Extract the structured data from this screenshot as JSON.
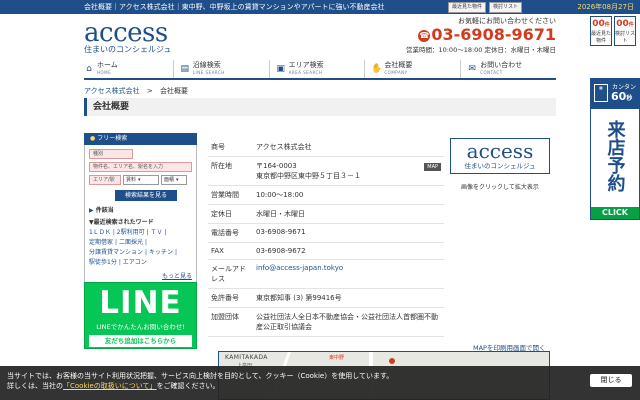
{
  "topbar": {
    "text": "会社概要｜アクセス株式会社｜東中野、中野坂上の賃貸マンションやアパートに強い不動産会社",
    "date": "2026年08月27日"
  },
  "logo": {
    "word": "access",
    "sub": "住まいのコンシェルジュ"
  },
  "header": {
    "tools": [
      "最近見た物件",
      "検討リスト"
    ],
    "tel_lead": "お気軽にお問い合わせください",
    "tel": "03-6908-9671",
    "hours": "営業時間：10:00〜18:00 定休日：水曜日・木曜日",
    "history": {
      "count": "00",
      "unit": "件",
      "label": "最近見た物件"
    },
    "watchlist": {
      "count": "00",
      "unit": "件",
      "label": "検討リスト"
    }
  },
  "nav": [
    {
      "label": "ホーム",
      "en": "HOME",
      "icon": "home-icon"
    },
    {
      "label": "沿線検索",
      "en": "LINE SEARCH",
      "icon": "train-icon"
    },
    {
      "label": "エリア検索",
      "en": "AREA SEARCH",
      "icon": "bus-icon"
    },
    {
      "label": "会社概要",
      "en": "COMPANY",
      "icon": "handshake-icon"
    },
    {
      "label": "お問い合わせ",
      "en": "CONTACT",
      "icon": "mail-icon"
    }
  ],
  "breadcrumb": {
    "home": "アクセス株式会社",
    "sep": ">",
    "current": "会社概要"
  },
  "page_title": "会社概要",
  "sidebar": {
    "header": "フリー検索",
    "type_placeholder": "種別",
    "keyword_placeholder": "物件名、エリア名、駅名を入力",
    "area_placeholder": "エリア/駅",
    "select_price": "賃料",
    "select_area": "面積",
    "search_button": "検索結果を見る",
    "cond_label": "件該当",
    "recent_title": "▼最近検索されたワード",
    "tags": [
      "1ＬＤＫ",
      "2駅利用可",
      "ＴＶ",
      "定期借家",
      "二面採光",
      "分譲賃貸マンション",
      "キッチン",
      "駅徒歩1分",
      "エアコン"
    ],
    "more": "もっと見る"
  },
  "line_banner": {
    "big": "LINE",
    "t2": "LINEでかんたんお問い合わせ!",
    "t3": "友だち追加はこちらから"
  },
  "company": [
    {
      "k": "商号",
      "v": "アクセス株式会社"
    },
    {
      "k": "所在地",
      "v1": "〒164-0003",
      "v2": "東京都中野区東中野５丁目３－１",
      "badge": "MAP"
    },
    {
      "k": "営業時間",
      "v": "10:00〜18:00"
    },
    {
      "k": "定休日",
      "v": "水曜日・木曜日"
    },
    {
      "k": "電話番号",
      "v": "03-6908-9671"
    },
    {
      "k": "FAX",
      "v": "03-6908-9672"
    },
    {
      "k": "メールアドレス",
      "v": "info@access-japan.tokyo"
    },
    {
      "k": "免許番号",
      "v": "東京都知事 (3) 第99416号"
    },
    {
      "k": "加盟団体",
      "v": "公益社団法人全日本不動産協会・公益社団法人首都圏不動産公正取引協議会"
    }
  ],
  "right_logo": {
    "word": "access",
    "sub": "住まいのコンシェルジュ",
    "caption": "画像をクリックして拡大表示"
  },
  "map": {
    "print": "MAPを印刷用画面で開く",
    "label1": "KAMITAKADA",
    "label2": "上高田",
    "label3": "東中野"
  },
  "reserve_banner": {
    "t1": "カンタン",
    "t2": "60",
    "t2_unit": "秒",
    "vert": "来店予約",
    "click": "CLICK"
  },
  "cookie": {
    "line1": "当サイトでは、お客様の当サイト利用状況把握、サービス向上検討を目的として、クッキー（Cookie）を使用しています。",
    "line2_a": "詳しくは、当社の",
    "link": "「Cookieの取扱いについて」",
    "line2_b": "をご確認ください。",
    "close": "閉じる"
  }
}
